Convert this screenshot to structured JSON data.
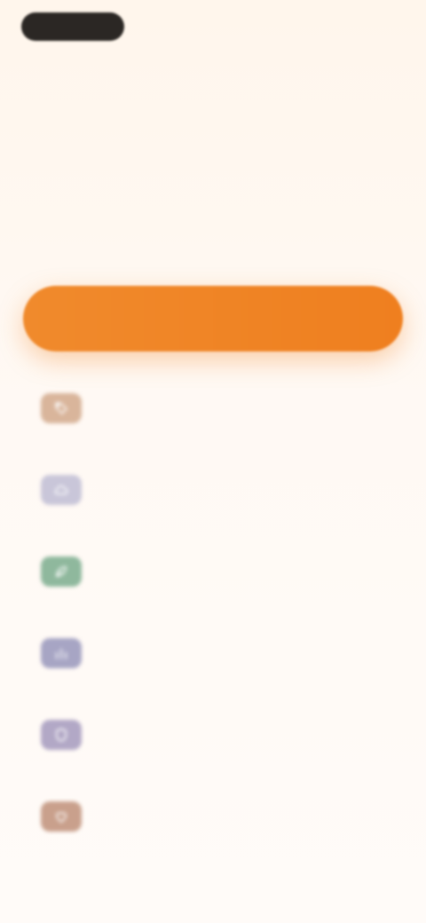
{
  "header": {
    "logo_text": "",
    "top_link": ""
  },
  "hero": {
    "title_line_1": "",
    "title_accent": "",
    "title_rest": ""
  },
  "cta": {
    "label": ""
  },
  "colors": {
    "accent": "#ef7f1f",
    "dark": "#2b2724",
    "background": "#fff9f3"
  },
  "features": [
    {
      "label": "",
      "icon": "tag-icon",
      "color": "#d9b59b"
    },
    {
      "label": "",
      "icon": "cloud-icon",
      "color": "#c9c6d9"
    },
    {
      "label": "",
      "icon": "leaf-icon",
      "color": "#8fb89d"
    },
    {
      "label": "",
      "icon": "chart-icon",
      "color": "#a7a5c4"
    },
    {
      "label": "",
      "icon": "shield-icon",
      "color": "#b2a8c6"
    },
    {
      "label": "",
      "icon": "heart-icon",
      "color": "#c9a08c"
    }
  ]
}
